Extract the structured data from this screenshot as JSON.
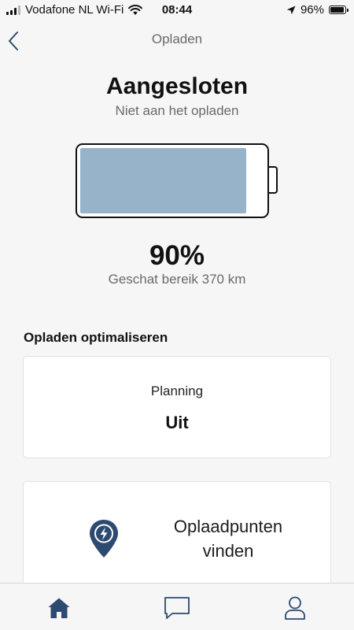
{
  "status_bar": {
    "carrier": "Vodafone NL Wi-Fi",
    "time": "08:44",
    "battery_percent": "96%",
    "battery_level": 0.96,
    "signal_bars_active": 3,
    "signal_bars_total": 4,
    "icons": [
      "signal-icon",
      "wifi-icon",
      "location-arrow-icon",
      "battery-icon"
    ]
  },
  "header": {
    "back_icon": "chevron-left-icon",
    "title": "Opladen"
  },
  "charging": {
    "status": "Aangesloten",
    "substatus": "Niet aan het opladen",
    "percent_text": "90%",
    "level": 0.9,
    "range_text": "Geschat bereik 370 km"
  },
  "optimize": {
    "heading": "Opladen optimaliseren",
    "planning": {
      "label": "Planning",
      "value": "Uit"
    }
  },
  "charge_points": {
    "icon": "charging-location-pin-icon",
    "label_line1": "Oplaadpunten",
    "label_line2": "vinden"
  },
  "tab_bar": {
    "tabs": [
      {
        "icon": "home-icon",
        "active": true
      },
      {
        "icon": "chat-icon",
        "active": false
      },
      {
        "icon": "profile-icon",
        "active": false
      }
    ]
  },
  "colors": {
    "accent": "#2d4a70",
    "battery_fill": "#97b3c9",
    "background": "#f6f6f6"
  }
}
